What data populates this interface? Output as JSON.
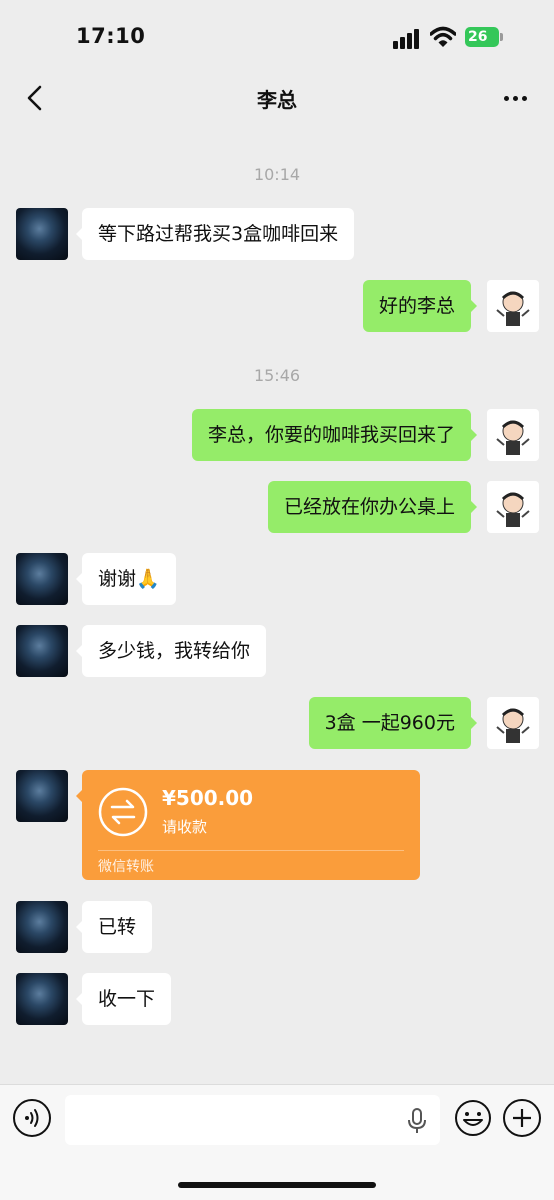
{
  "status_bar": {
    "time": "17:10",
    "battery": "26"
  },
  "nav": {
    "title": "李总"
  },
  "messages": {
    "t1": "10:14",
    "m1": "等下路过帮我买3盒咖啡回来",
    "m2": "好的李总",
    "t2": "15:46",
    "m3": "李总，你要的咖啡我买回来了",
    "m4": "已经放在你办公桌上",
    "m5": "谢谢🙏",
    "m6": "多少钱，我转给你",
    "m7": "3盒 一起960元",
    "transfer": {
      "amount": "¥500.00",
      "status": "请收款",
      "source": "微信转账"
    },
    "m8": "已转",
    "m9": "收一下"
  },
  "icons": {
    "back": "chevron-left-icon",
    "more": "more-dots-icon",
    "voice": "voice-icon",
    "mic": "mic-icon",
    "emoji": "emoji-icon",
    "plus": "plus-icon",
    "transfer": "transfer-icon"
  },
  "colors": {
    "sent_bubble": "#95ec69",
    "received_bubble": "#ffffff",
    "transfer_card": "#fa9d3b",
    "background": "#ededed",
    "battery": "#34c759"
  }
}
